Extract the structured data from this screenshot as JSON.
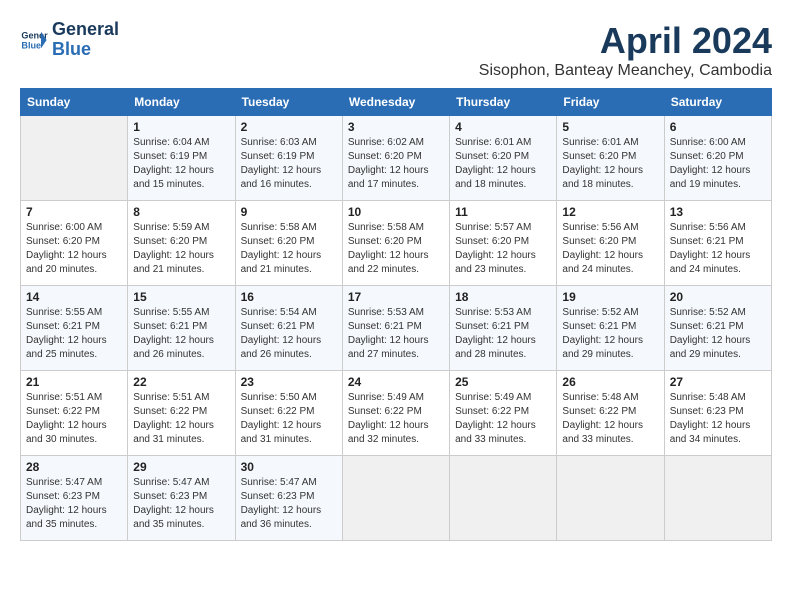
{
  "logo": {
    "line1": "General",
    "line2": "Blue"
  },
  "title": "April 2024",
  "subtitle": "Sisophon, Banteay Meanchey, Cambodia",
  "weekdays": [
    "Sunday",
    "Monday",
    "Tuesday",
    "Wednesday",
    "Thursday",
    "Friday",
    "Saturday"
  ],
  "weeks": [
    [
      {
        "day": "",
        "info": ""
      },
      {
        "day": "1",
        "info": "Sunrise: 6:04 AM\nSunset: 6:19 PM\nDaylight: 12 hours\nand 15 minutes."
      },
      {
        "day": "2",
        "info": "Sunrise: 6:03 AM\nSunset: 6:19 PM\nDaylight: 12 hours\nand 16 minutes."
      },
      {
        "day": "3",
        "info": "Sunrise: 6:02 AM\nSunset: 6:20 PM\nDaylight: 12 hours\nand 17 minutes."
      },
      {
        "day": "4",
        "info": "Sunrise: 6:01 AM\nSunset: 6:20 PM\nDaylight: 12 hours\nand 18 minutes."
      },
      {
        "day": "5",
        "info": "Sunrise: 6:01 AM\nSunset: 6:20 PM\nDaylight: 12 hours\nand 18 minutes."
      },
      {
        "day": "6",
        "info": "Sunrise: 6:00 AM\nSunset: 6:20 PM\nDaylight: 12 hours\nand 19 minutes."
      }
    ],
    [
      {
        "day": "7",
        "info": "Sunrise: 6:00 AM\nSunset: 6:20 PM\nDaylight: 12 hours\nand 20 minutes."
      },
      {
        "day": "8",
        "info": "Sunrise: 5:59 AM\nSunset: 6:20 PM\nDaylight: 12 hours\nand 21 minutes."
      },
      {
        "day": "9",
        "info": "Sunrise: 5:58 AM\nSunset: 6:20 PM\nDaylight: 12 hours\nand 21 minutes."
      },
      {
        "day": "10",
        "info": "Sunrise: 5:58 AM\nSunset: 6:20 PM\nDaylight: 12 hours\nand 22 minutes."
      },
      {
        "day": "11",
        "info": "Sunrise: 5:57 AM\nSunset: 6:20 PM\nDaylight: 12 hours\nand 23 minutes."
      },
      {
        "day": "12",
        "info": "Sunrise: 5:56 AM\nSunset: 6:20 PM\nDaylight: 12 hours\nand 24 minutes."
      },
      {
        "day": "13",
        "info": "Sunrise: 5:56 AM\nSunset: 6:21 PM\nDaylight: 12 hours\nand 24 minutes."
      }
    ],
    [
      {
        "day": "14",
        "info": "Sunrise: 5:55 AM\nSunset: 6:21 PM\nDaylight: 12 hours\nand 25 minutes."
      },
      {
        "day": "15",
        "info": "Sunrise: 5:55 AM\nSunset: 6:21 PM\nDaylight: 12 hours\nand 26 minutes."
      },
      {
        "day": "16",
        "info": "Sunrise: 5:54 AM\nSunset: 6:21 PM\nDaylight: 12 hours\nand 26 minutes."
      },
      {
        "day": "17",
        "info": "Sunrise: 5:53 AM\nSunset: 6:21 PM\nDaylight: 12 hours\nand 27 minutes."
      },
      {
        "day": "18",
        "info": "Sunrise: 5:53 AM\nSunset: 6:21 PM\nDaylight: 12 hours\nand 28 minutes."
      },
      {
        "day": "19",
        "info": "Sunrise: 5:52 AM\nSunset: 6:21 PM\nDaylight: 12 hours\nand 29 minutes."
      },
      {
        "day": "20",
        "info": "Sunrise: 5:52 AM\nSunset: 6:21 PM\nDaylight: 12 hours\nand 29 minutes."
      }
    ],
    [
      {
        "day": "21",
        "info": "Sunrise: 5:51 AM\nSunset: 6:22 PM\nDaylight: 12 hours\nand 30 minutes."
      },
      {
        "day": "22",
        "info": "Sunrise: 5:51 AM\nSunset: 6:22 PM\nDaylight: 12 hours\nand 31 minutes."
      },
      {
        "day": "23",
        "info": "Sunrise: 5:50 AM\nSunset: 6:22 PM\nDaylight: 12 hours\nand 31 minutes."
      },
      {
        "day": "24",
        "info": "Sunrise: 5:49 AM\nSunset: 6:22 PM\nDaylight: 12 hours\nand 32 minutes."
      },
      {
        "day": "25",
        "info": "Sunrise: 5:49 AM\nSunset: 6:22 PM\nDaylight: 12 hours\nand 33 minutes."
      },
      {
        "day": "26",
        "info": "Sunrise: 5:48 AM\nSunset: 6:22 PM\nDaylight: 12 hours\nand 33 minutes."
      },
      {
        "day": "27",
        "info": "Sunrise: 5:48 AM\nSunset: 6:23 PM\nDaylight: 12 hours\nand 34 minutes."
      }
    ],
    [
      {
        "day": "28",
        "info": "Sunrise: 5:47 AM\nSunset: 6:23 PM\nDaylight: 12 hours\nand 35 minutes."
      },
      {
        "day": "29",
        "info": "Sunrise: 5:47 AM\nSunset: 6:23 PM\nDaylight: 12 hours\nand 35 minutes."
      },
      {
        "day": "30",
        "info": "Sunrise: 5:47 AM\nSunset: 6:23 PM\nDaylight: 12 hours\nand 36 minutes."
      },
      {
        "day": "",
        "info": ""
      },
      {
        "day": "",
        "info": ""
      },
      {
        "day": "",
        "info": ""
      },
      {
        "day": "",
        "info": ""
      }
    ]
  ]
}
